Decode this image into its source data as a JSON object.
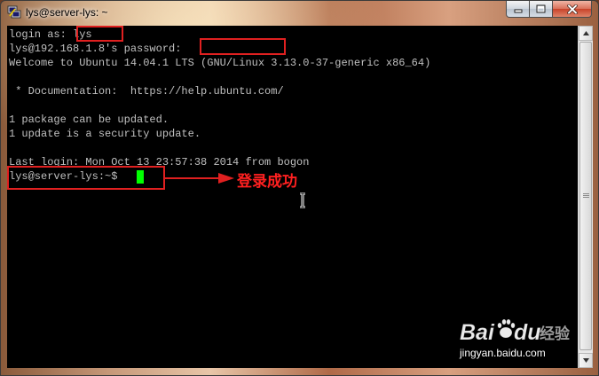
{
  "window": {
    "title": "lys@server-lys: ~"
  },
  "terminal": {
    "lines": [
      "login as: lys",
      "lys@192.168.1.8's password:",
      "Welcome to Ubuntu 14.04.1 LTS (GNU/Linux 3.13.0-37-generic x86_64)",
      "",
      " * Documentation:  https://help.ubuntu.com/",
      "",
      "1 package can be updated.",
      "1 update is a security update.",
      "",
      "Last login: Mon Oct 13 23:57:38 2014 from bogon",
      "lys@server-lys:~$ "
    ]
  },
  "annotation": {
    "label": "登录成功",
    "color": "#e02020"
  },
  "watermark": {
    "brand": "Baidu经验",
    "url": "jingyan.baidu.com"
  },
  "colors": {
    "terminal_bg": "#000000",
    "terminal_fg": "#c0c0c0",
    "cursor": "#00ff00"
  },
  "icons": {
    "app": "putty-icon",
    "minimize": "minimize-icon",
    "maximize": "maximize-icon",
    "close": "close-icon"
  }
}
